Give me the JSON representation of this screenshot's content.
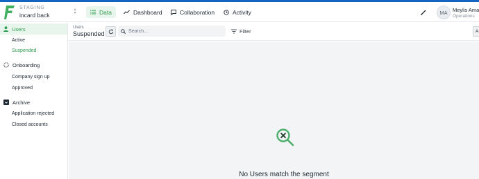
{
  "header": {
    "environment_label": "STAGING",
    "environment_name": "incard back",
    "brand_color": "#2e9d4f",
    "tabs": [
      {
        "label": "Data",
        "icon": "list-icon",
        "active": true
      },
      {
        "label": "Dashboard",
        "icon": "trend-line-icon",
        "active": false
      },
      {
        "label": "Collaboration",
        "icon": "comment-icon",
        "active": false
      },
      {
        "label": "Activity",
        "icon": "history-icon",
        "active": false
      }
    ],
    "user": {
      "initials": "MA",
      "name": "Meylis Aman",
      "role": "Operations"
    }
  },
  "sidebar": {
    "sections": [
      {
        "label": "Users",
        "icon": "user-icon",
        "active": true,
        "items": [
          {
            "label": "Active",
            "active": false
          },
          {
            "label": "Suspended",
            "active": true
          }
        ]
      },
      {
        "label": "Onboarding",
        "icon": "spinner-icon",
        "active": false,
        "items": [
          {
            "label": "Company sign up",
            "active": false
          },
          {
            "label": "Approved",
            "active": false
          }
        ]
      },
      {
        "label": "Archive",
        "icon": "archive-icon",
        "active": false,
        "items": [
          {
            "label": "Application rejected",
            "active": false
          },
          {
            "label": "Closed accounts",
            "active": false
          }
        ]
      }
    ]
  },
  "toolbar": {
    "collection": "Users",
    "segment": "Suspended",
    "search_placeholder": "Search...",
    "filter_label": "Filter",
    "right_button_label": "A"
  },
  "main": {
    "empty_message": "No Users match the segment"
  }
}
